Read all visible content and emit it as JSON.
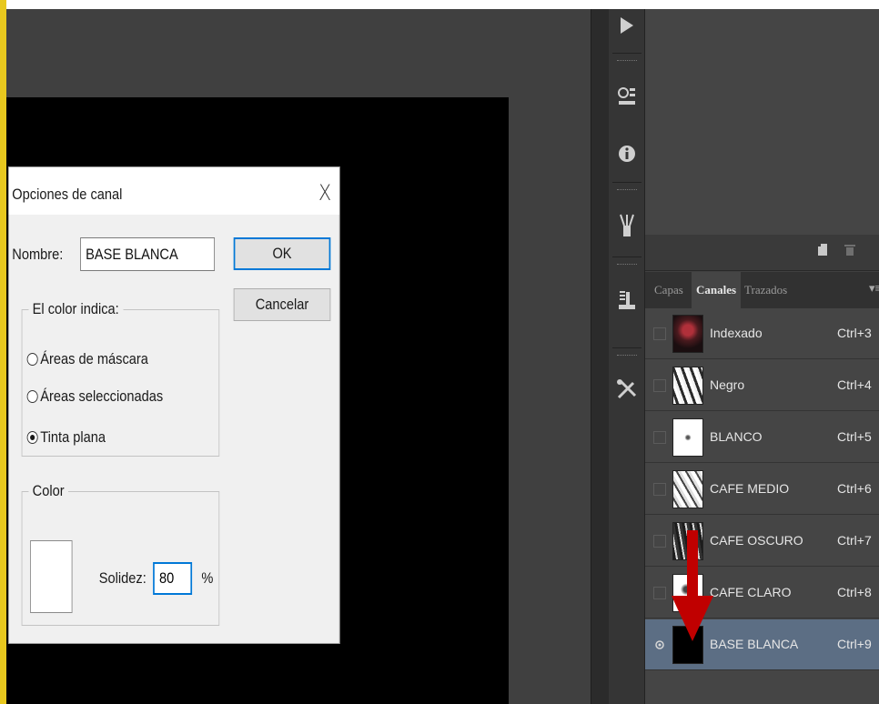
{
  "dialog": {
    "title": "Opciones de canal",
    "close_glyph": "X",
    "name_label": "Nombre:",
    "name_value": "BASE BLANCA",
    "ok_label": "OK",
    "cancel_label": "Cancelar",
    "color_indicates_legend": "El color indica:",
    "options": [
      "Áreas de máscara",
      "Áreas seleccionadas",
      "Tinta plana"
    ],
    "selected_option": "Tinta plana",
    "color_legend": "Color",
    "solidity_label": "Solidez:",
    "solidity_value": "80",
    "percent_sign": "%"
  },
  "panel": {
    "tabs": [
      "Capas",
      "Canales",
      "Trazados"
    ],
    "active_tab": "Canales",
    "channels": [
      {
        "name": "Indexado",
        "shortcut": "Ctrl+3",
        "thumb": "dark-red"
      },
      {
        "name": "Negro",
        "shortcut": "Ctrl+4",
        "thumb": "mixed"
      },
      {
        "name": "BLANCO",
        "shortcut": "Ctrl+5",
        "thumb": "light"
      },
      {
        "name": "CAFE MEDIO",
        "shortcut": "Ctrl+6",
        "thumb": "mixed"
      },
      {
        "name": "CAFE OSCURO",
        "shortcut": "Ctrl+7",
        "thumb": "mixed"
      },
      {
        "name": "CAFE CLARO",
        "shortcut": "Ctrl+8",
        "thumb": "light"
      },
      {
        "name": "BASE BLANCA",
        "shortcut": "Ctrl+9",
        "thumb": "black"
      }
    ],
    "selected_channel": "BASE BLANCA"
  },
  "colors": {
    "accent_blue": "#0078d7",
    "selection_row": "#5c6e84",
    "arrow_red": "#c00000",
    "frame_yellow": "#e8c81e"
  }
}
